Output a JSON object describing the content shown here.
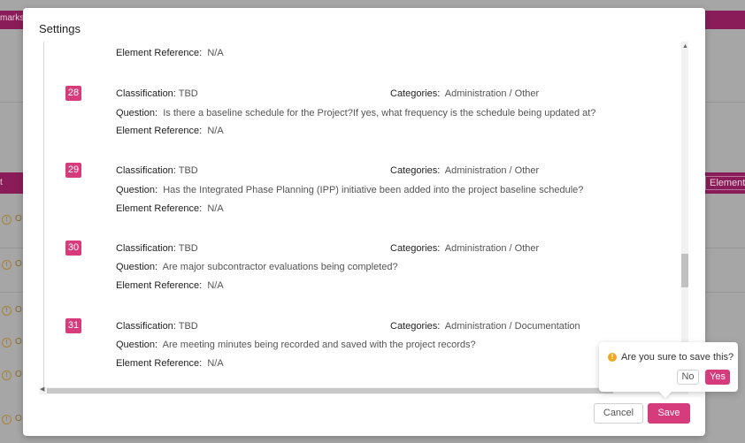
{
  "background": {
    "topbar_text": "marks",
    "bar_text": "t",
    "element_button": "Element",
    "row_text": "O"
  },
  "modal": {
    "title": "Settings",
    "labels": {
      "classification": "Classification:",
      "categories": "Categories:",
      "question": "Question:",
      "element_reference": "Element Reference:"
    },
    "top_element_reference_value": "N/A",
    "items": [
      {
        "number": "28",
        "classification": "TBD",
        "categories": "Administration / Other",
        "question": "Is there a baseline schedule for the Project?If yes, what frequency is the schedule being updated at?",
        "element_reference": "N/A"
      },
      {
        "number": "29",
        "classification": "TBD",
        "categories": "Administration / Other",
        "question": "Has the Integrated Phase Planning (IPP) initiative been added into the project baseline schedule?",
        "element_reference": "N/A"
      },
      {
        "number": "30",
        "classification": "TBD",
        "categories": "Administration / Other",
        "question": "Are major subcontractor evaluations being completed?",
        "element_reference": "N/A"
      },
      {
        "number": "31",
        "classification": "TBD",
        "categories": "Administration / Documentation",
        "question": "Are meeting minutes being recorded and saved with the project records?",
        "element_reference": "N/A"
      }
    ],
    "cancel_label": "Cancel",
    "save_label": "Save"
  },
  "popconfirm": {
    "message": "Are you sure to save this?",
    "no_label": "No",
    "yes_label": "Yes",
    "icon": "exclamation-circle-icon"
  },
  "colors": {
    "accent": "#d63b7c",
    "warning": "#f0a820",
    "background_bar": "#8a1d59"
  }
}
